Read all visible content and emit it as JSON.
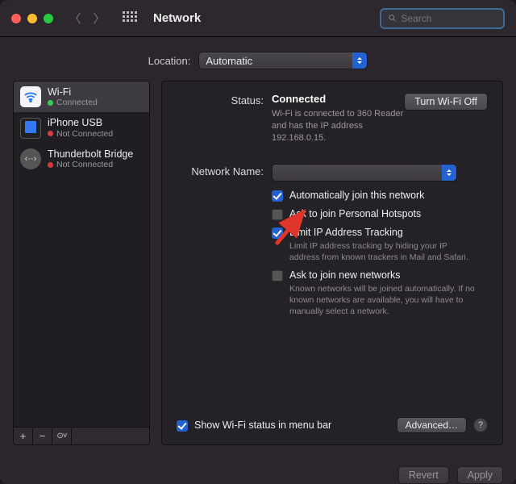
{
  "window": {
    "title": "Network"
  },
  "search": {
    "placeholder": "Search"
  },
  "location": {
    "label": "Location:",
    "value": "Automatic"
  },
  "sidebar": {
    "items": [
      {
        "name": "Wi-Fi",
        "status": "Connected",
        "dot": "green"
      },
      {
        "name": "iPhone USB",
        "status": "Not Connected",
        "dot": "red"
      },
      {
        "name": "Thunderbolt Bridge",
        "status": "Not Connected",
        "dot": "red"
      }
    ],
    "footer": {
      "plus": "+",
      "minus": "−",
      "gear": "⊙˅"
    }
  },
  "main": {
    "status_label": "Status:",
    "status_value": "Connected",
    "turn_off": "Turn Wi-Fi Off",
    "status_detail": "Wi-Fi is connected to 360 Reader and has the IP address 192.168.0.15.",
    "netname_label": "Network Name:",
    "netname_value": "",
    "checks": {
      "auto_join": "Automatically join this network",
      "ask_hotspot": "Ask to join Personal Hotspots",
      "limit_ip": "Limit IP Address Tracking",
      "limit_ip_desc": "Limit IP address tracking by hiding your IP address from known trackers in Mail and Safari.",
      "ask_new": "Ask to join new networks",
      "ask_new_desc": "Known networks will be joined automatically. If no known networks are available, you will have to manually select a network."
    },
    "show_menu": "Show Wi-Fi status in menu bar",
    "advanced": "Advanced…"
  },
  "footer": {
    "revert": "Revert",
    "apply": "Apply"
  }
}
